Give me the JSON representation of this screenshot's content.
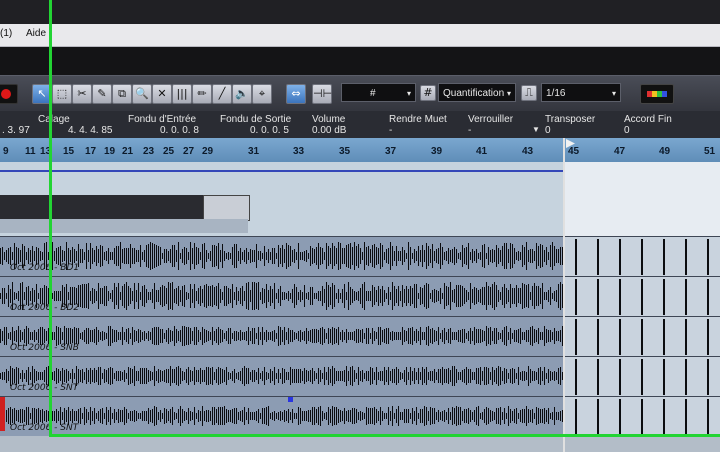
{
  "menu": {
    "item_prefix": "(1)",
    "help": "Aide"
  },
  "toolbar": {
    "grid_select": "#",
    "quantize_label": "Quantification",
    "quantize_value": "1/16"
  },
  "infoline": {
    "left_value": ". 3. 97",
    "columns": [
      {
        "label": "Calage",
        "value": "4. 4. 4. 85"
      },
      {
        "label": "Fondu d'Entrée",
        "value": "0. 0. 0.    8"
      },
      {
        "label": "Fondu de Sortie",
        "value": "0. 0. 0.    5"
      },
      {
        "label": "Volume",
        "value": "0.00 dB"
      },
      {
        "label": "Rendre Muet",
        "value": "-"
      },
      {
        "label": "Verrouiller",
        "value": "-"
      },
      {
        "label": "Transposer",
        "value": "0"
      },
      {
        "label": "Accord Fin",
        "value": "0"
      }
    ]
  },
  "ruler": {
    "ticks": [
      "9",
      "11",
      "13",
      "15",
      "17",
      "19",
      "21",
      "23",
      "25",
      "27",
      "29",
      "31",
      "33",
      "35",
      "37",
      "39",
      "41",
      "43",
      "45",
      "47",
      "49",
      "51"
    ]
  },
  "tracks": [
    {
      "name": "Oct 2006 - BD1"
    },
    {
      "name": "Oct 2006 - BD2"
    },
    {
      "name": "Oct 2006 - SNB"
    },
    {
      "name": "Oct 2006 - SNT"
    },
    {
      "name": "Oct 2006 - SNT"
    }
  ],
  "colors": {
    "highlight_frame": "#22d433",
    "ruler": "#6a98c4",
    "toolbar": "#3d4049"
  }
}
